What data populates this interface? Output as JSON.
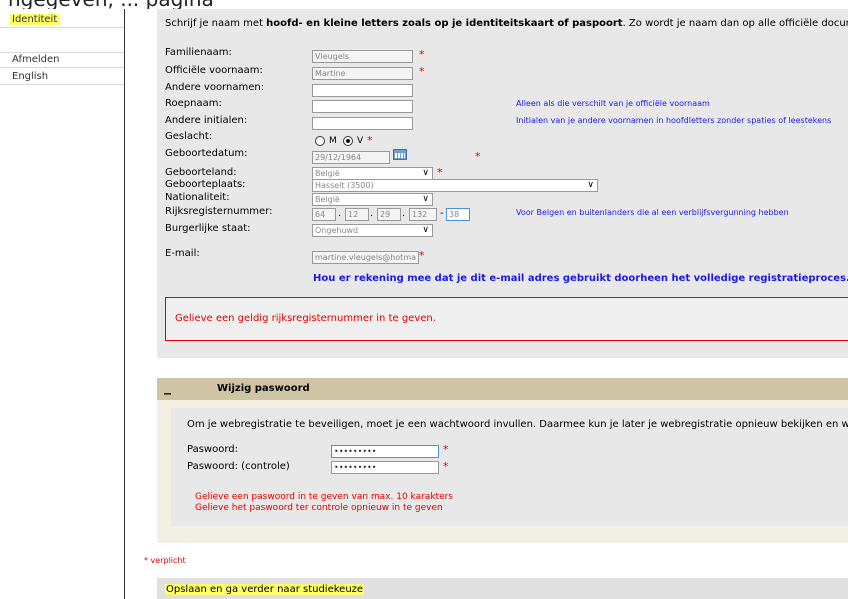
{
  "top_text": "ngegeven, ... pagina",
  "sidebar": {
    "items": [
      {
        "label": "Identiteit",
        "active": true
      },
      {
        "label": "Afmelden"
      },
      {
        "label": "English"
      }
    ]
  },
  "identity": {
    "intro_prefix": "Schrijf je naam met ",
    "intro_bold": "hoofd- en kleine letters zoals op je identiteitskaart of paspoort",
    "intro_suffix": ". Zo wordt je naam dan op alle officiële documenten gespeld.",
    "fields": {
      "familienaam": {
        "label": "Familienaam:",
        "value": "Vleugels"
      },
      "voornaam": {
        "label": "Officiële voornaam:",
        "value": "Martine"
      },
      "andere_voornamen": {
        "label": "Andere voornamen:",
        "value": ""
      },
      "roepnaam": {
        "label": "Roepnaam:",
        "value": "",
        "note": "Alleen als die verschilt van je officiële voornaam"
      },
      "initialen": {
        "label": "Andere initialen:",
        "value": "",
        "note": "Initialen van je andere voornamen in hoofdletters zonder spaties of leestekens"
      },
      "geslacht": {
        "label": "Geslacht:",
        "option_m": "M",
        "option_v": "V",
        "selected": "V"
      },
      "geboortedatum": {
        "label": "Geboortedatum:",
        "value": "29/12/1964"
      },
      "geboorteland": {
        "label": "Geboorteland:",
        "value": "België"
      },
      "geboorteplaats": {
        "label": "Geboorteplaats:",
        "value": "Hasselt (3500)"
      },
      "nationaliteit": {
        "label": "Nationaliteit:",
        "value": "België"
      },
      "rijksregister": {
        "label": "Rijksregisternummer:",
        "p1": "64",
        "p2": "12",
        "p3": "29",
        "p4": "132",
        "p5": "38",
        "note": "Voor Belgen en buitenlanders die al een verblijfsvergunning hebben"
      },
      "burgerlijke_staat": {
        "label": "Burgerlijke staat:",
        "value": "Ongehuwd"
      },
      "email": {
        "label": "E-mail:",
        "value": "martine.vleugels@hotma"
      }
    },
    "email_warning": "Hou er rekening mee dat je dit e-mail adres gebruikt doorheen het volledige registratieproces.",
    "error": "Gelieve een geldig rijksregisternummer in te geven."
  },
  "password_panel": {
    "toggle": "_",
    "title": "Wijzig paswoord",
    "intro": "Om je webregistratie te beveiligen, moet je een wachtwoord invullen. Daarmee kun je later je webregistratie opnieuw bekijken en wijzigen.",
    "pw_label": "Paswoord:",
    "pw_value": "•••••••••",
    "pw2_label": "Paswoord: (controle)",
    "pw2_value": "•••••••••",
    "error1": "Gelieve een paswoord in te geven van max. 10 karakters",
    "error2": "Gelieve het paswoord ter controle opnieuw in te geven"
  },
  "required_note": "* verplicht",
  "required_star": "*",
  "save_label": "Opslaan en ga verder naar studiekeuze",
  "colors": {
    "highlight": "#ffff66",
    "error": "#e00000",
    "note": "#1a1ae6",
    "panel_header": "#cfc5a5"
  }
}
